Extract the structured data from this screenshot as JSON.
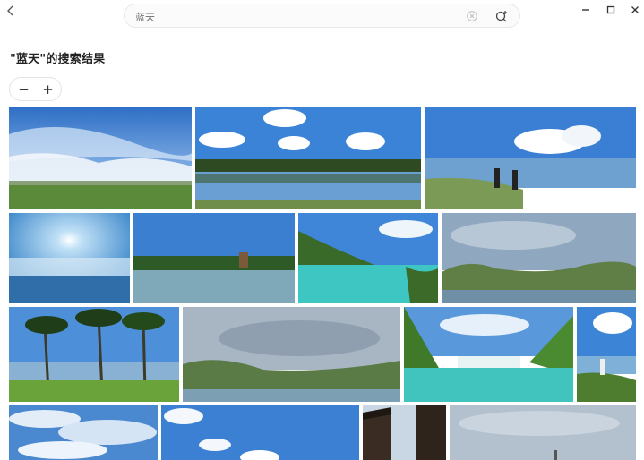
{
  "toolbar": {
    "search_query": "蓝天",
    "back_icon": "chevron-left-icon",
    "clear_icon": "circle-x-icon",
    "image_search_icon": "image-search-icon",
    "window_controls": [
      "minimize-icon",
      "maximize-icon",
      "close-icon"
    ]
  },
  "results": {
    "heading": "\"蓝天\"的搜索结果",
    "zoom_out_label": "−",
    "zoom_in_label": "+",
    "photo_count_visible": 16
  },
  "colors": {
    "sky_blue": "#3f7fd0",
    "text": "#222222",
    "border": "#e4e4e4"
  }
}
